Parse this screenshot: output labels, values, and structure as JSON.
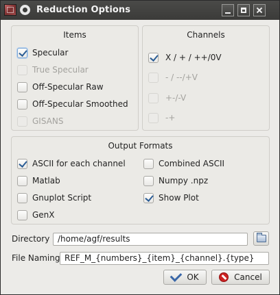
{
  "window": {
    "title": "Reduction Options",
    "icon": "app-icon",
    "controls": [
      "minimize-icon",
      "maximize-icon",
      "close-icon"
    ]
  },
  "items": {
    "title": "Items",
    "options": [
      {
        "label": "Specular",
        "checked": true,
        "enabled": true
      },
      {
        "label": "True Specular",
        "checked": false,
        "enabled": false
      },
      {
        "label": "Off-Specular Raw",
        "checked": false,
        "enabled": true
      },
      {
        "label": "Off-Specular Smoothed",
        "checked": false,
        "enabled": true
      },
      {
        "label": "GISANS",
        "checked": false,
        "enabled": false
      }
    ]
  },
  "channels": {
    "title": "Channels",
    "options": [
      {
        "label": "X / + / ++/0V",
        "checked": true,
        "enabled": true
      },
      {
        "label": "- / --/+V",
        "checked": false,
        "enabled": false
      },
      {
        "label": "+-/-V",
        "checked": false,
        "enabled": false
      },
      {
        "label": "-+",
        "checked": false,
        "enabled": false
      }
    ]
  },
  "output_formats": {
    "title": "Output Formats",
    "left": [
      {
        "label": "ASCII for each channel",
        "checked": true
      },
      {
        "label": "Matlab",
        "checked": false
      },
      {
        "label": "Gnuplot Script",
        "checked": false
      },
      {
        "label": "GenX",
        "checked": false
      }
    ],
    "right": [
      {
        "label": "Combined ASCII",
        "checked": false
      },
      {
        "label": "Numpy .npz",
        "checked": false
      },
      {
        "label": "Show Plot",
        "checked": true
      }
    ]
  },
  "directory": {
    "label": "Directory",
    "value": "/home/agf/results",
    "browse_icon": "folder-icon"
  },
  "file_naming": {
    "label": "File Naming",
    "value": "REF_M_{numbers}_{item}_{channel}.{type}"
  },
  "buttons": {
    "ok": "OK",
    "cancel": "Cancel"
  },
  "colors": {
    "check": "#2b5d95",
    "cancel_icon": "#cc2222",
    "titlebar": "#3b3b39"
  }
}
